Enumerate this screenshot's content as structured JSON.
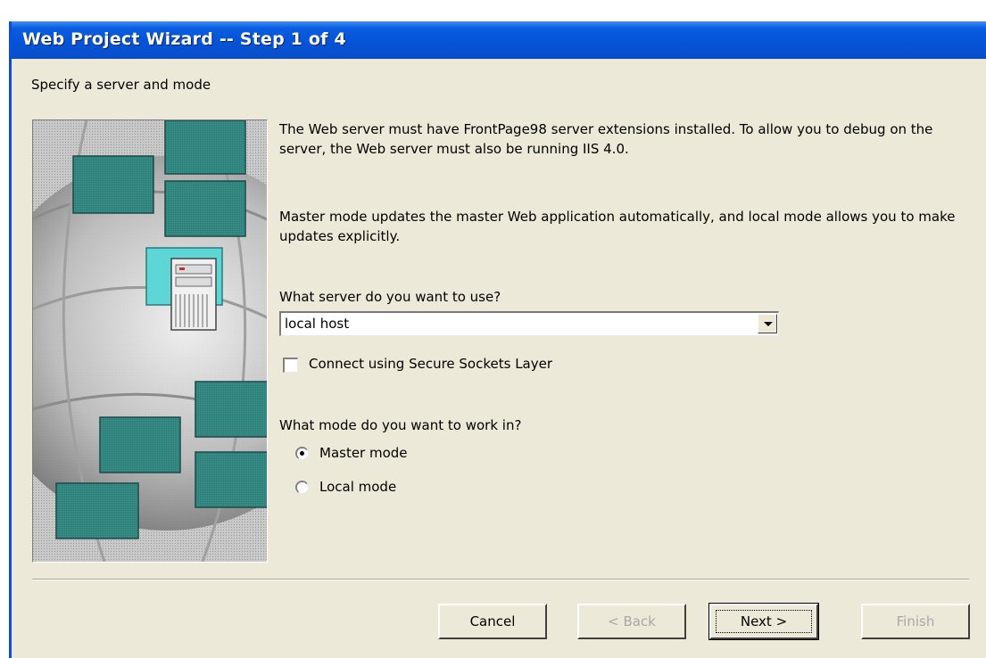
{
  "window": {
    "title": "Web Project Wizard -- Step 1 of 4",
    "subtitle": "Specify a server and mode"
  },
  "content": {
    "paragraph1": "The Web server must have FrontPage98 server extensions installed. To allow you to debug on the server, the Web server must also be running IIS 4.0.",
    "paragraph2": "Master mode updates the master Web application automatically, and local mode allows you to make updates explicitly.",
    "server_question": "What server do you want to use?",
    "server_value": "local host",
    "ssl_checkbox_label": "Connect using Secure Sockets Layer",
    "ssl_checked": false,
    "mode_question": "What mode do you want to work in?",
    "modes": [
      {
        "label": "Master mode",
        "selected": true
      },
      {
        "label": "Local mode",
        "selected": false
      }
    ]
  },
  "buttons": {
    "cancel": "Cancel",
    "back": "< Back",
    "next": "Next >",
    "finish": "Finish"
  },
  "icons": {
    "dropdown": "chevron-down-icon",
    "illustration": "network-server-illustration"
  },
  "colors": {
    "titlebar": "#0453d6",
    "dialog_bg": "#ece9d8",
    "tile": "#2f7f7a",
    "server_monitor": "#5ed6d6"
  }
}
